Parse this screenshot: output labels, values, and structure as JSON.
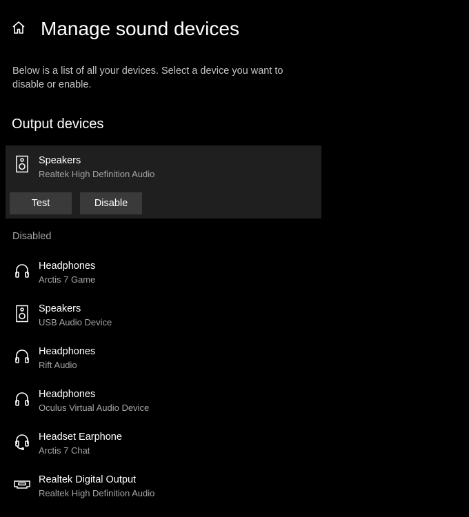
{
  "header": {
    "title": "Manage sound devices",
    "home_icon": "home-icon"
  },
  "description": "Below is a list of all your devices. Select a device you want to disable or enable.",
  "output_section": {
    "title": "Output devices",
    "selected": {
      "name": "Speakers",
      "sub": "Realtek High Definition Audio",
      "icon": "speaker-icon",
      "test_label": "Test",
      "disable_label": "Disable"
    }
  },
  "disabled_label": "Disabled",
  "disabled_devices": [
    {
      "name": "Headphones",
      "sub": "Arctis 7 Game",
      "icon": "headphones-icon"
    },
    {
      "name": "Speakers",
      "sub": "USB Audio Device",
      "icon": "speaker-icon"
    },
    {
      "name": "Headphones",
      "sub": "Rift Audio",
      "icon": "headphones-icon"
    },
    {
      "name": "Headphones",
      "sub": "Oculus Virtual Audio Device",
      "icon": "headphones-icon"
    },
    {
      "name": "Headset Earphone",
      "sub": "Arctis 7 Chat",
      "icon": "headset-icon"
    },
    {
      "name": "Realtek Digital Output",
      "sub": "Realtek High Definition Audio",
      "icon": "digital-output-icon"
    }
  ]
}
